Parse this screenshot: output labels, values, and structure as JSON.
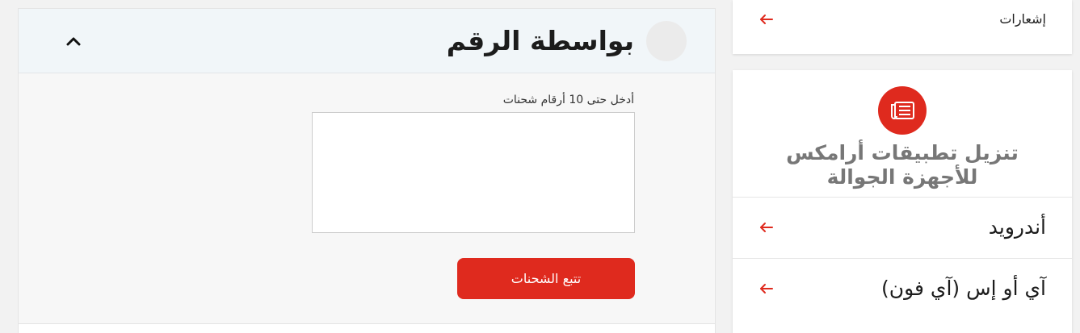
{
  "tracking": {
    "title": "بواسطة الرقم",
    "input_label": "أدخل حتى 10 أرقام شحنات",
    "input_value": "",
    "input_placeholder": "",
    "button_label": "تتبع الشحنات"
  },
  "sidebar": {
    "notifications_label": "إشعارات",
    "apps_title": "تنزيل تطبيقات أرامكس للأجهزة الجوالة",
    "android_label": "أندرويد",
    "ios_label": "آي أو إس (آي فون)"
  },
  "colors": {
    "accent": "#df2a1e",
    "header_bg": "#f1f6f9",
    "panel_bg": "#f7f7f7"
  },
  "icons": {
    "collapse": "chevron-up-icon",
    "arrow": "arrow-left-icon",
    "app_badge": "newspaper-icon"
  }
}
